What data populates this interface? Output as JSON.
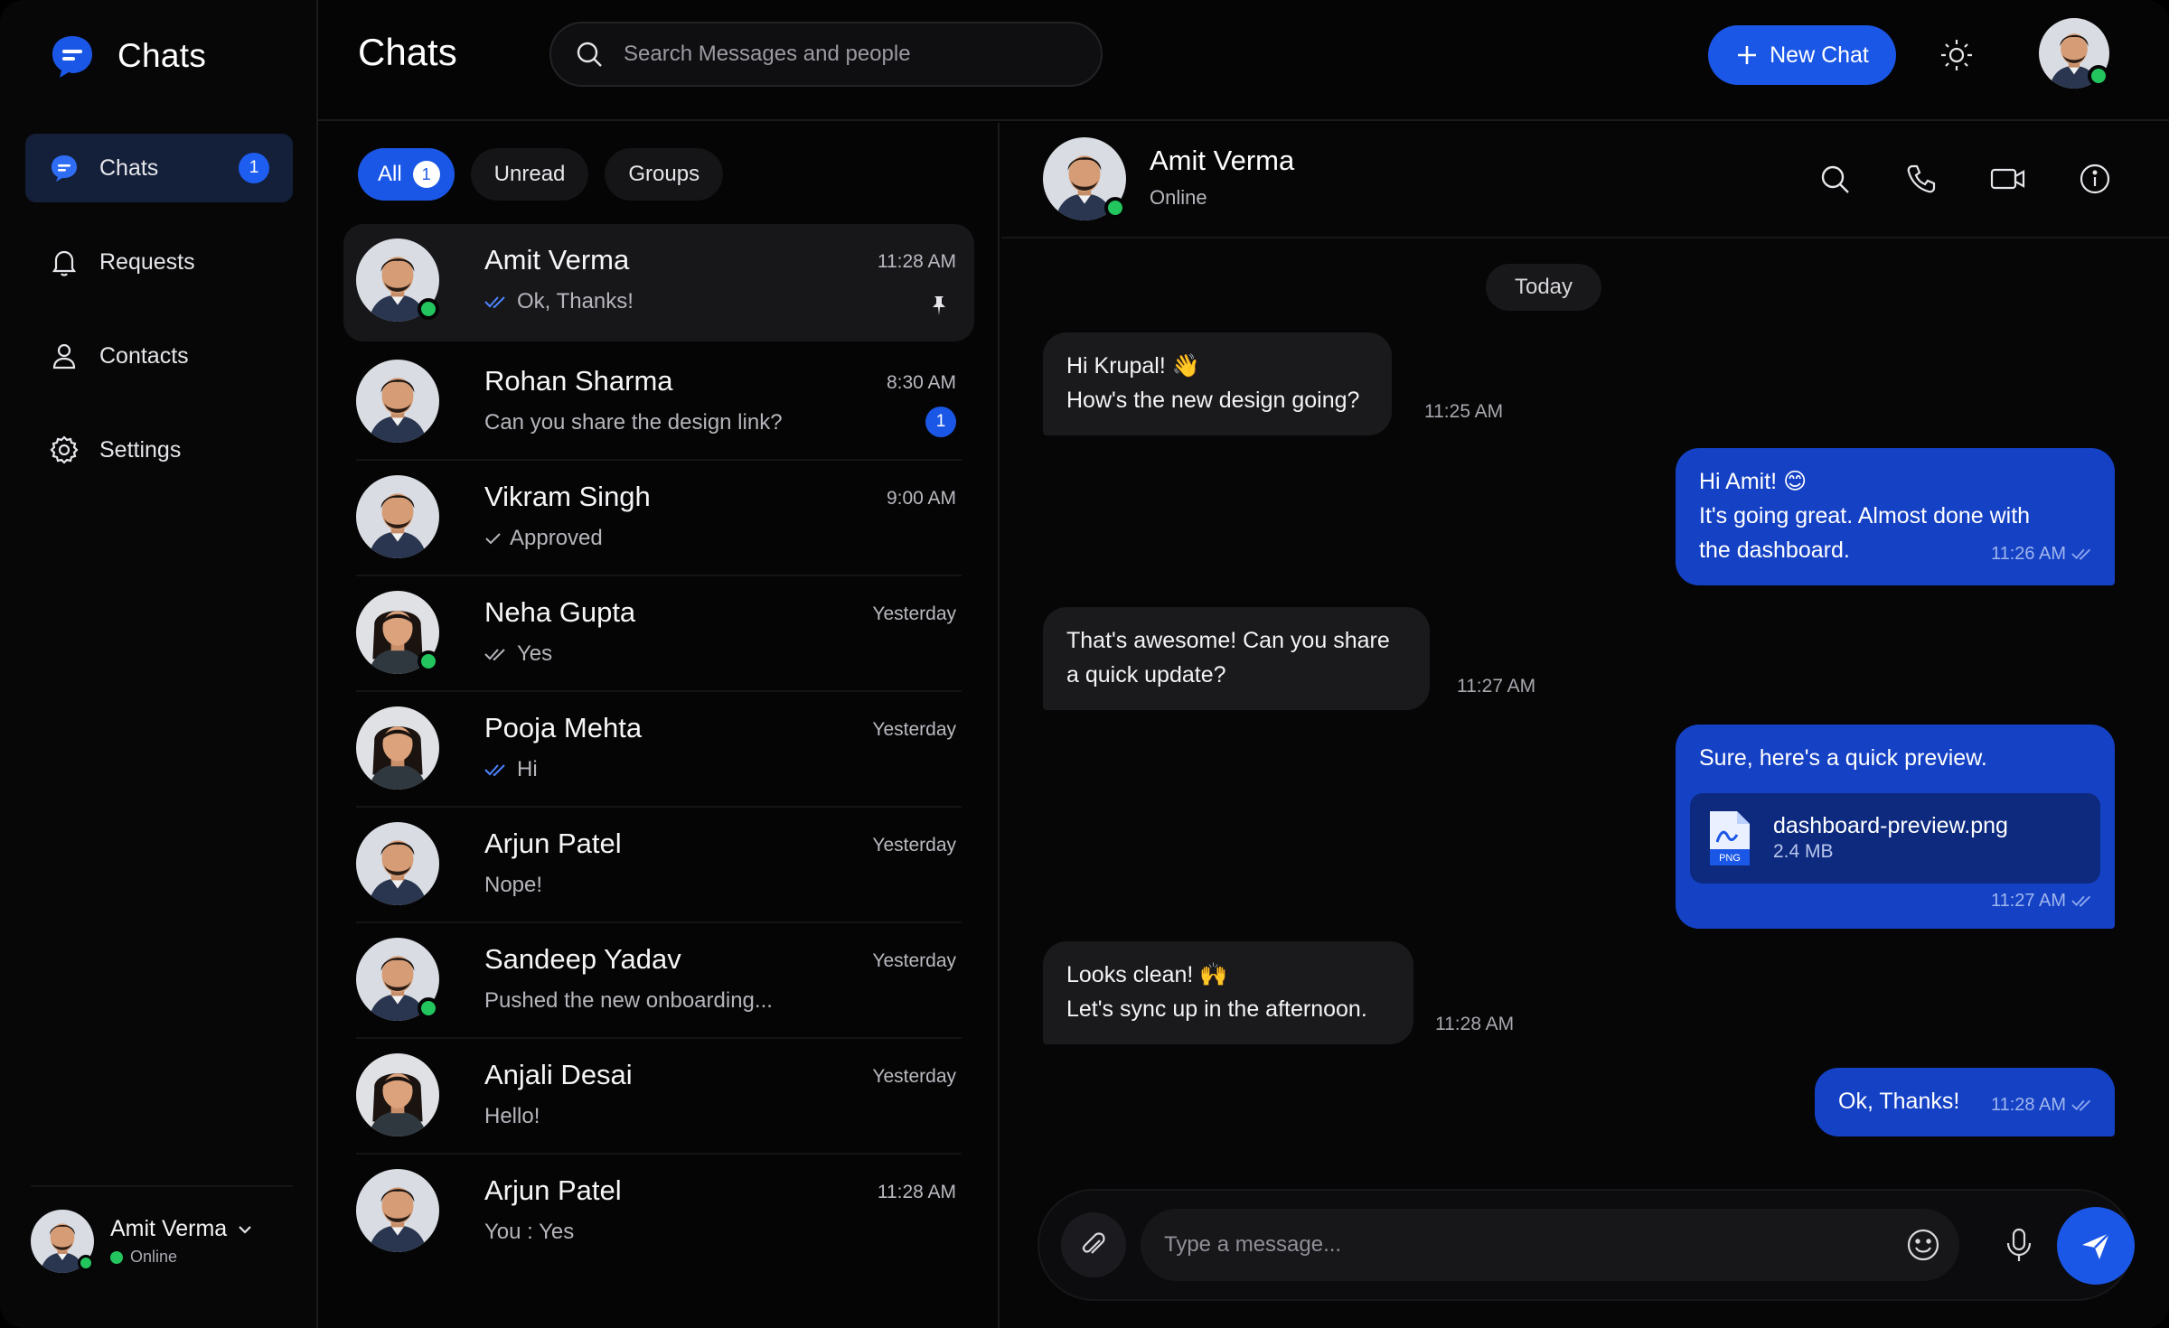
{
  "brand": {
    "title": "Chats"
  },
  "sidebar": {
    "items": [
      {
        "label": "Chats",
        "icon": "chat-icon",
        "badge": "1",
        "active": true
      },
      {
        "label": "Requests",
        "icon": "bell-icon"
      },
      {
        "label": "Contacts",
        "icon": "user-icon"
      },
      {
        "label": "Settings",
        "icon": "gear-icon"
      }
    ],
    "current_user": {
      "name": "Amit Verma",
      "status": "Online"
    }
  },
  "header": {
    "title": "Chats",
    "search_placeholder": "Search Messages and people",
    "new_chat_label": "New Chat"
  },
  "filters": [
    {
      "label": "All",
      "count": "1",
      "active": true
    },
    {
      "label": "Unread"
    },
    {
      "label": "Groups"
    }
  ],
  "chats": [
    {
      "name": "Amit Verma",
      "time": "11:28 AM",
      "preview": "Ok, Thanks!",
      "tick": "double-blue",
      "pinned": true,
      "online": true,
      "active": true
    },
    {
      "name": "Rohan Sharma",
      "time": "8:30 AM",
      "preview": "Can you share the design link?",
      "unread": "1"
    },
    {
      "name": "Vikram Singh",
      "time": "9:00 AM",
      "preview": "Approved",
      "tick": "single"
    },
    {
      "name": "Neha Gupta",
      "time": "Yesterday",
      "preview": "Yes",
      "tick": "double-gray",
      "online": true
    },
    {
      "name": "Pooja Mehta",
      "time": "Yesterday",
      "preview": "Hi",
      "tick": "double-blue"
    },
    {
      "name": "Arjun Patel",
      "time": "Yesterday",
      "preview": "Nope!"
    },
    {
      "name": "Sandeep Yadav",
      "time": "Yesterday",
      "preview": "Pushed the new onboarding...",
      "online": true
    },
    {
      "name": "Anjali Desai",
      "time": "Yesterday",
      "preview": "Hello!"
    },
    {
      "name": "Arjun Patel",
      "time": "11:28 AM",
      "preview": "You : Yes"
    }
  ],
  "conversation": {
    "name": "Amit Verma",
    "status": "Online",
    "day_label": "Today",
    "messages": [
      {
        "dir": "in",
        "lines": [
          "Hi Krupal! 👋",
          "How's the new design going?"
        ],
        "time": "11:25 AM"
      },
      {
        "dir": "out",
        "lines": [
          "Hi Amit! 😊",
          "It's going great. Almost done with",
          "the dashboard."
        ],
        "time": "11:26 AM"
      },
      {
        "dir": "in",
        "lines": [
          "That's awesome! Can you share",
          "a quick update?"
        ],
        "time": "11:27 AM"
      },
      {
        "dir": "out",
        "lines": [
          "Sure, here's a quick preview."
        ],
        "time": "11:27 AM",
        "file": {
          "name": "dashboard-preview.png",
          "size": "2.4 MB",
          "type": "PNG"
        }
      },
      {
        "dir": "in",
        "lines": [
          "Looks clean! 🙌",
          "Let's sync up in the afternoon."
        ],
        "time": "11:28 AM"
      },
      {
        "dir": "out",
        "lines": [
          "Ok, Thanks!"
        ],
        "time": "11:28 AM"
      }
    ],
    "composer_placeholder": "Type a message..."
  },
  "colors": {
    "accent": "#1b57e6",
    "bubble_out": "#1541c4",
    "bubble_in": "#1a1a1d",
    "online": "#22c55e",
    "background": "#050505"
  }
}
